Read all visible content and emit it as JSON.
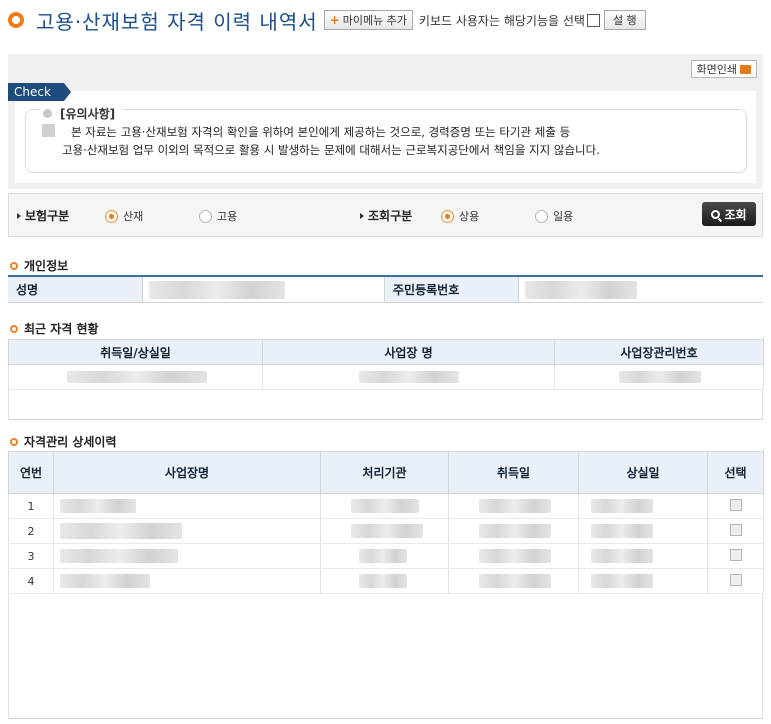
{
  "header": {
    "title": "고용·산재보험 자격 이력 내역서",
    "mymenu_plus": "+",
    "mymenu_label": "마이메뉴 추가",
    "keyboard_text": "키보드 사용자는 해당기능을 선택",
    "setup_label": "설 행"
  },
  "toolbar": {
    "print_label": "화면인쇄"
  },
  "notice": {
    "tag": "Check",
    "heading": "[유의사항]",
    "line1": "본 자료는 고용·산재보험 자격의 확인을 위하여 본인에게 제공하는 것으로, 경력증명 또는 타기관 제출 등",
    "line2": "고용·산재보험 업무 이외의 목적으로 활용 시 발생하는 문제에 대해서는 근로복지공단에서 책임을 지지 않습니다."
  },
  "search": {
    "insurance_label": "보험구분",
    "insurance_options": [
      "산재",
      "고용"
    ],
    "insurance_selected": "산재",
    "query_type_label": "조회구분",
    "query_type_options": [
      "상용",
      "일용"
    ],
    "query_type_selected": "상용",
    "query_button": "조회"
  },
  "personal": {
    "section_title": "개인정보",
    "name_label": "성명",
    "rrn_label": "주민등록번호"
  },
  "recent": {
    "section_title": "최근 자격 현황",
    "columns": [
      "취득일/상실일",
      "사업장 명",
      "사업장관리번호"
    ]
  },
  "history": {
    "section_title": "자격관리 상세이력",
    "columns": [
      "연번",
      "사업장명",
      "처리기관",
      "취득일",
      "상실일",
      "선택"
    ],
    "rows": [
      {
        "no": "1"
      },
      {
        "no": "2"
      },
      {
        "no": "3"
      },
      {
        "no": "4"
      }
    ]
  },
  "colors": {
    "accent_orange": "#e07b1a",
    "title_blue": "#1d4f8a",
    "header_bg": "#eaf0f8",
    "check_tag": "#1e4c7c"
  }
}
